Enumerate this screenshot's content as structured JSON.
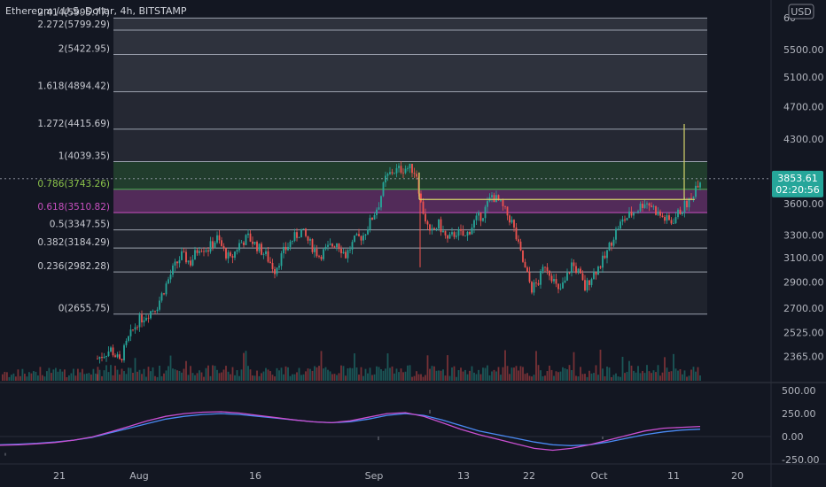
{
  "header": {
    "title": "Ethereum / U.S. Dollar, 4h, BITSTAMP",
    "currency_badge": "USD"
  },
  "price_tag": {
    "price": "3853.61",
    "countdown": "02:20:56"
  },
  "colors": {
    "background": "#131722",
    "up": "#26a69a",
    "down": "#ef5350",
    "fib_line": "#9aa0ad",
    "fib_green": "#4caf50",
    "fib_magenta": "#c850c0",
    "range_box": "#d4d46a",
    "price_tag_bg": "#26a69a",
    "osc_blue": "#4a8af4",
    "osc_magenta": "#c84fd0"
  },
  "chart_data": [
    {
      "type": "candlestick",
      "title": "Ethereum / U.S. Dollar, 4h, BITSTAMP",
      "y_scale": "log",
      "ylim": [
        2200,
        6300
      ],
      "y_ticks": [
        2365,
        2525,
        2700,
        2900,
        3100,
        3300,
        3600,
        3900,
        4300,
        4700,
        5100,
        5500,
        6000
      ],
      "y_tick_labels": [
        "2365.00",
        "2525.00",
        "2700.00",
        "2900.00",
        "3100.00",
        "3300.00",
        "3600.00",
        "3900.00",
        "4300.00",
        "4700.00",
        "5100.00",
        "5500.00",
        "60"
      ],
      "x_tick_labels": [
        "21",
        "Aug",
        "16",
        "Sep",
        "13",
        "22",
        "Oct",
        "11",
        "20"
      ],
      "fib_levels": [
        {
          "label": "0(2655.75)",
          "level": 0,
          "value": 2655.75
        },
        {
          "label": "0.236(2982.28)",
          "level": 0.236,
          "value": 2982.28
        },
        {
          "label": "0.382(3184.29)",
          "level": 0.382,
          "value": 3184.29
        },
        {
          "label": "0.5(3347.55)",
          "level": 0.5,
          "value": 3347.55
        },
        {
          "label": "0.618(3510.82)",
          "level": 0.618,
          "value": 3510.82
        },
        {
          "label": "0.786(3743.26)",
          "level": 0.786,
          "value": 3743.26
        },
        {
          "label": "1(4039.35)",
          "level": 1,
          "value": 4039.35
        },
        {
          "label": "1.272(4415.69)",
          "level": 1.272,
          "value": 4415.69
        },
        {
          "label": "1.618(4894.42)",
          "level": 1.618,
          "value": 4894.42
        },
        {
          "label": "2(5422.95)",
          "level": 2,
          "value": 5422.95
        },
        {
          "label": "2.272(5799.29)",
          "level": 2.272,
          "value": 5799.29
        },
        {
          "label": "2.414(5995.77)",
          "level": 2.414,
          "value": 5995.77
        }
      ],
      "last_price": 3853.61,
      "price_anchors": [
        [
          0,
          2350
        ],
        [
          6,
          2410
        ],
        [
          10,
          2330
        ],
        [
          14,
          2480
        ],
        [
          18,
          2600
        ],
        [
          22,
          2650
        ],
        [
          27,
          2720
        ],
        [
          31,
          2880
        ],
        [
          34,
          3000
        ],
        [
          38,
          3120
        ],
        [
          42,
          3060
        ],
        [
          46,
          3200
        ],
        [
          50,
          3180
        ],
        [
          54,
          3270
        ],
        [
          57,
          3160
        ],
        [
          60,
          3080
        ],
        [
          64,
          3220
        ],
        [
          68,
          3280
        ],
        [
          72,
          3200
        ],
        [
          76,
          3120
        ],
        [
          80,
          3000
        ],
        [
          84,
          3150
        ],
        [
          88,
          3260
        ],
        [
          92,
          3340
        ],
        [
          96,
          3220
        ],
        [
          100,
          3120
        ],
        [
          104,
          3180
        ],
        [
          108,
          3240
        ],
        [
          112,
          3120
        ],
        [
          116,
          3250
        ],
        [
          120,
          3300
        ],
        [
          123,
          3420
        ],
        [
          127,
          3600
        ],
        [
          130,
          3850
        ],
        [
          133,
          3930
        ],
        [
          136,
          3950
        ],
        [
          139,
          3970
        ],
        [
          142,
          3960
        ],
        [
          144,
          3900
        ],
        [
          146,
          3600
        ],
        [
          148,
          3450
        ],
        [
          150,
          3300
        ],
        [
          154,
          3400
        ],
        [
          158,
          3250
        ],
        [
          162,
          3330
        ],
        [
          166,
          3280
        ],
        [
          170,
          3420
        ],
        [
          174,
          3500
        ],
        [
          178,
          3680
        ],
        [
          181,
          3620
        ],
        [
          184,
          3520
        ],
        [
          187,
          3420
        ],
        [
          190,
          3200
        ],
        [
          193,
          3000
        ],
        [
          196,
          2850
        ],
        [
          199,
          2900
        ],
        [
          202,
          3050
        ],
        [
          205,
          2950
        ],
        [
          208,
          2820
        ],
        [
          211,
          2900
        ],
        [
          214,
          3050
        ],
        [
          217,
          2980
        ],
        [
          220,
          2850
        ],
        [
          223,
          2950
        ],
        [
          226,
          3020
        ],
        [
          229,
          3100
        ],
        [
          232,
          3250
        ],
        [
          235,
          3380
        ],
        [
          238,
          3450
        ],
        [
          241,
          3500
        ],
        [
          244,
          3550
        ],
        [
          247,
          3620
        ],
        [
          250,
          3580
        ],
        [
          253,
          3500
        ],
        [
          256,
          3450
        ],
        [
          259,
          3420
        ],
        [
          262,
          3500
        ],
        [
          265,
          3580
        ],
        [
          268,
          3640
        ],
        [
          270,
          3780
        ],
        [
          272,
          3853.61
        ]
      ],
      "volume_note": "histogram of volume bars, up/down colored"
    },
    {
      "type": "line",
      "name": "oscillator",
      "ylim": [
        -300,
        550
      ],
      "y_ticks": [
        -250,
        0,
        250,
        500
      ],
      "y_tick_labels": [
        "-250.00",
        "0.00",
        "250.00",
        "500.00"
      ],
      "series": [
        {
          "color": "#4a8af4",
          "values": [
            -90,
            -85,
            -75,
            -60,
            -40,
            -10,
            40,
            90,
            140,
            190,
            220,
            240,
            250,
            240,
            220,
            200,
            180,
            160,
            150,
            160,
            190,
            230,
            250,
            230,
            180,
            120,
            60,
            20,
            -20,
            -60,
            -90,
            -100,
            -90,
            -60,
            -20,
            20,
            50,
            70,
            80
          ]
        },
        {
          "color": "#c84fd0",
          "values": [
            -95,
            -90,
            -80,
            -65,
            -40,
            -5,
            50,
            110,
            170,
            220,
            250,
            265,
            270,
            255,
            230,
            205,
            180,
            160,
            150,
            170,
            210,
            250,
            260,
            220,
            150,
            80,
            20,
            -30,
            -80,
            -130,
            -150,
            -130,
            -90,
            -40,
            10,
            60,
            90,
            100,
            110
          ]
        }
      ]
    }
  ]
}
